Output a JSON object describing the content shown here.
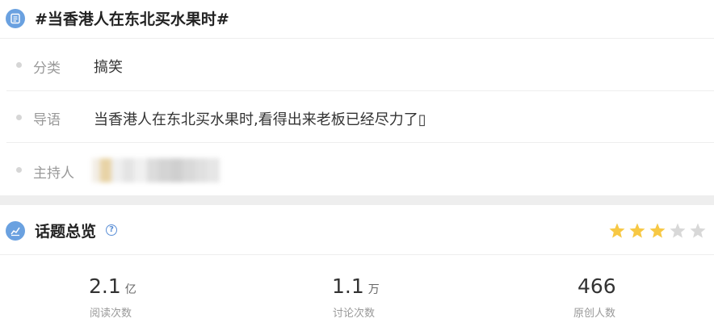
{
  "topic": {
    "title": "#当香港人在东北买水果时#",
    "icon": "list-doc-icon"
  },
  "info": {
    "category": {
      "label": "分类",
      "value": "搞笑"
    },
    "intro": {
      "label": "导语",
      "value": "当香港人在东北买水果时,看得出来老板已经尽力了▯"
    },
    "host": {
      "label": "主持人",
      "value_state": "blurred"
    }
  },
  "overview": {
    "title": "话题总览",
    "help_icon": "question-circle-icon",
    "rating": {
      "filled": 3,
      "max": 5,
      "filled_color": "#f7c844",
      "empty_color": "#d8d8d8"
    },
    "stats": [
      {
        "number": "2.1",
        "unit": "亿",
        "caption": "阅读次数"
      },
      {
        "number": "1.1",
        "unit": "万",
        "caption": "讨论次数"
      },
      {
        "number": "466",
        "unit": "",
        "caption": "原创人数"
      }
    ]
  },
  "colors": {
    "accent": "#6aa1e0",
    "divider": "#eeeeee"
  }
}
